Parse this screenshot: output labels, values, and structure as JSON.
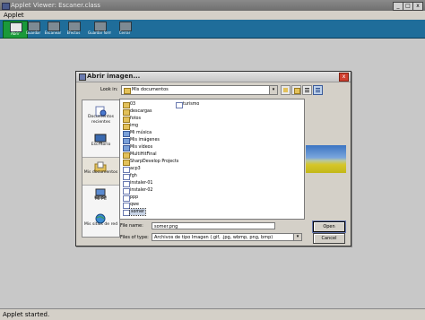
{
  "window": {
    "title": "Applet Viewer: Escaner.class",
    "controls": [
      "_",
      "□",
      "x"
    ]
  },
  "menubar": {
    "items": [
      "Applet"
    ]
  },
  "toolbar": {
    "buttons": [
      {
        "label": "Abrir",
        "icon": "open-icon",
        "active": true
      },
      {
        "label": "Guardar",
        "icon": "save-icon"
      },
      {
        "label": "Escanear",
        "icon": "scanner-icon"
      },
      {
        "label": "Efectos",
        "icon": "effects-icon"
      },
      {
        "label": "Guardar formato",
        "icon": "save-format-icon"
      },
      {
        "label": "Cerrar",
        "icon": "close-icon"
      }
    ]
  },
  "dialog": {
    "title": "Abrir imagen...",
    "close": "x",
    "look_in": {
      "label": "Look in:",
      "value": "Mis documentos",
      "arrow": "▾"
    },
    "places": [
      {
        "label": "Documentos recientes",
        "icon": "recent-documents-icon"
      },
      {
        "label": "Escritorio",
        "icon": "desktop-icon"
      },
      {
        "label": "Mis documentos",
        "icon": "my-documents-icon",
        "selected": true
      },
      {
        "label": "Mi PC",
        "icon": "my-computer-icon"
      },
      {
        "label": "Mis sitios de red",
        "icon": "network-places-icon"
      }
    ],
    "files": [
      {
        "name": "03",
        "type": "folder"
      },
      {
        "name": "descargas",
        "type": "folder"
      },
      {
        "name": "fotos",
        "type": "folder"
      },
      {
        "name": "img",
        "type": "folder"
      },
      {
        "name": "Mi música",
        "type": "special"
      },
      {
        "name": "Mis imágenes",
        "type": "special"
      },
      {
        "name": "Mis vídeos",
        "type": "special"
      },
      {
        "name": "MultiHitFinal",
        "type": "folder"
      },
      {
        "name": "SharpDevelop Projects",
        "type": "folder"
      },
      {
        "name": "acp3",
        "type": "file"
      },
      {
        "name": "fgh",
        "type": "file"
      },
      {
        "name": "instaler-01",
        "type": "file"
      },
      {
        "name": "instaler-02",
        "type": "file"
      },
      {
        "name": "ppp",
        "type": "file"
      },
      {
        "name": "qwe",
        "type": "file"
      },
      {
        "name": "somer",
        "type": "file",
        "selected": true
      },
      {
        "name": "turismo",
        "type": "file"
      }
    ],
    "file_name": {
      "label": "File name:",
      "value": "somer.png"
    },
    "files_of_type": {
      "label": "Files of type:",
      "value": "Archivos de tipo Imagen (.gif, .jpg, wbmp, png, bmp)",
      "arrow": "▾"
    },
    "open_label": "Open",
    "cancel_label": "Cancel"
  },
  "status": {
    "text": "Applet started."
  }
}
